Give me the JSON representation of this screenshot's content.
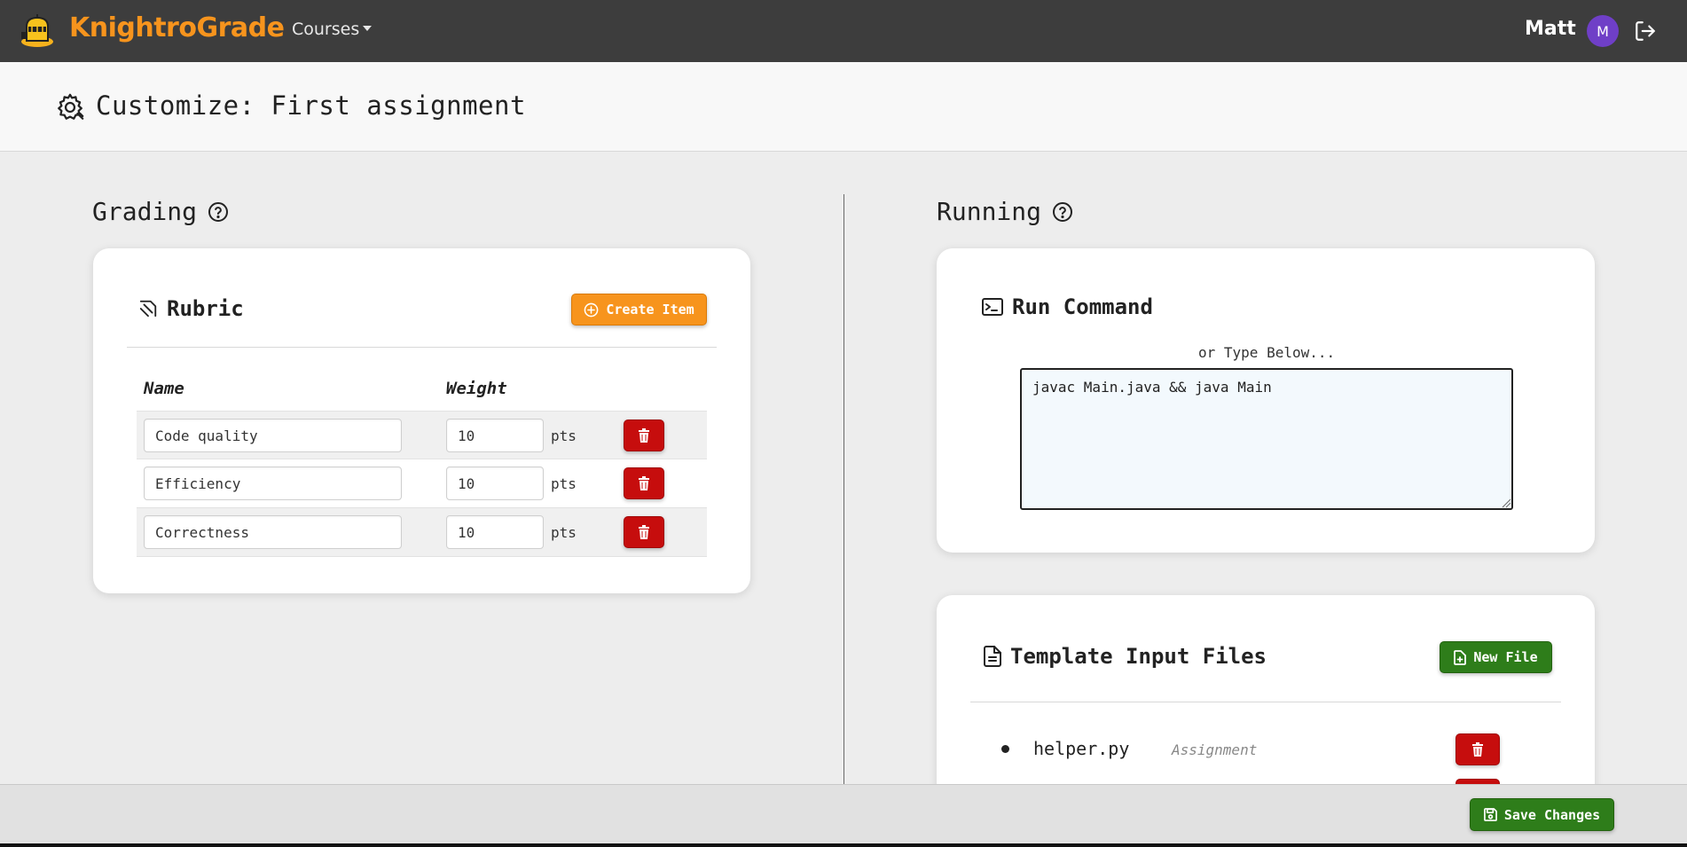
{
  "navbar": {
    "brand": "KnightroGrade",
    "courses_label": "Courses",
    "username": "Matt",
    "avatar_initial": "M"
  },
  "page": {
    "title": "Customize: First assignment"
  },
  "grading": {
    "heading": "Grading",
    "rubric": {
      "title": "Rubric",
      "create_button": "Create Item",
      "col_name": "Name",
      "col_weight": "Weight",
      "items": [
        {
          "name": "Code quality",
          "weight": "10",
          "unit": "pts"
        },
        {
          "name": "Efficiency",
          "weight": "10",
          "unit": "pts"
        },
        {
          "name": "Correctness",
          "weight": "10",
          "unit": "pts"
        }
      ]
    }
  },
  "running": {
    "heading": "Running",
    "run_command": {
      "title": "Run Command",
      "hint": "or Type Below...",
      "value": "javac Main.java && java Main"
    },
    "template_files": {
      "title": "Template Input Files",
      "new_file_button": "New File",
      "files": [
        {
          "name": "helper.py",
          "tag": "Assignment"
        }
      ]
    }
  },
  "footer": {
    "save_button": "Save Changes"
  },
  "colors": {
    "navbar_bg": "#3d3d3d",
    "brand": "#f7941d",
    "avatar": "#6f3fc7",
    "orange_button": "#f7941d",
    "green_button": "#2e7d1a",
    "red_button": "#c60d0d"
  }
}
